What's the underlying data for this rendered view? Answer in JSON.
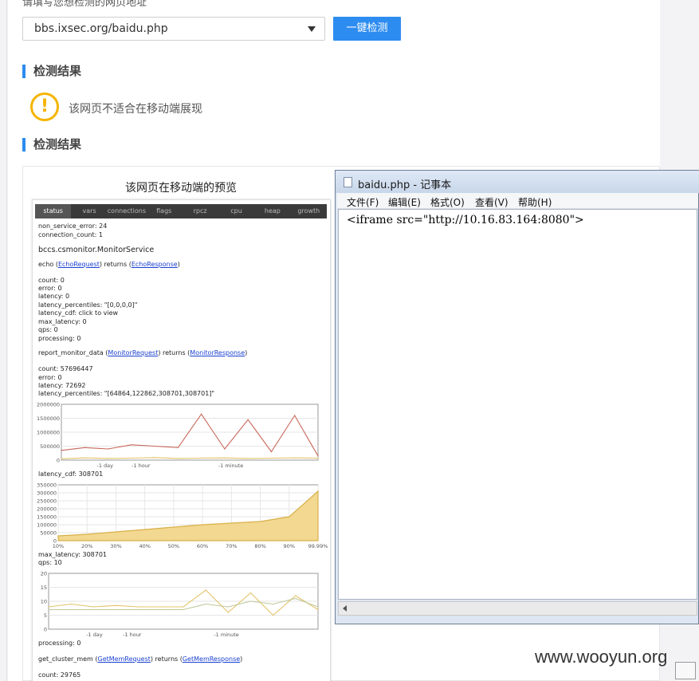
{
  "top_cut_label": "请填写您想检测的网页地址",
  "url_input": {
    "value": "bbs.ixsec.org/baidu.php"
  },
  "check_button": "一键检测",
  "section1_title": "检测结果",
  "warning_text": "该网页不适合在移动端展现",
  "warning_icon": "exclamation-circle-icon",
  "section2_title": "检测结果",
  "preview_title": "该网页在移动端的预览",
  "accent_color": "#2d8cf0",
  "warn_color": "#f5b400",
  "mobile": {
    "tabs": [
      "status",
      "vars",
      "connections",
      "flags",
      "rpcz",
      "cpu",
      "heap",
      "growth"
    ],
    "lines": {
      "l1": "non_service_error: 24",
      "l2": "connection_count: 1",
      "service": "bccs.csmonitor.MonitorService",
      "echo_a": "echo (",
      "echo_req": "EchoRequest",
      "echo_b": ") returns (",
      "echo_resp": "EchoResponse",
      "echo_c": ")",
      "e1": "count: 0",
      "e2": "error: 0",
      "e3": "latency: 0",
      "e4": "latency_percentiles: \"[0,0,0,0]\"",
      "e5": "latency_cdf: click to view",
      "e6": "max_latency: 0",
      "e7": "qps: 0",
      "e8": "processing: 0",
      "rm_a": "report_monitor_data (",
      "rm_req": "MonitorRequest",
      "rm_b": ") returns (",
      "rm_resp": "MonitorResponse",
      "rm_c": ")",
      "r1": "count: 57696447",
      "r2": "error: 0",
      "r3": "latency: 72692",
      "r4": "latency_percentiles: \"[64864,122862,308701,308701]\"",
      "cdf": "latency_cdf: 308701",
      "maxl": "max_latency: 308701",
      "qps": "qps: 10",
      "proc": "processing: 0",
      "gc_a": "get_cluster_mem (",
      "gc_req": "GetMemRequest",
      "gc_b": ") returns (",
      "gc_resp": "GetMemResponse",
      "gc_c": ")",
      "gcount": "count: 29765"
    },
    "chart1": {
      "y_ticks": [
        "2000000",
        "1500000",
        "1000000",
        "500000",
        "0"
      ],
      "x_ticks": [
        "-1 day",
        "-1 hour",
        "-1 minute"
      ]
    },
    "chart2": {
      "y_ticks": [
        "350000",
        "300000",
        "250000",
        "200000",
        "150000",
        "100000",
        "50000",
        "0"
      ],
      "x_ticks": [
        "10%",
        "20%",
        "30%",
        "40%",
        "50%",
        "60%",
        "70%",
        "80%",
        "90%",
        "99.99%"
      ]
    },
    "chart3": {
      "y_ticks": [
        "20",
        "15",
        "10",
        "5",
        "0"
      ],
      "x_ticks": [
        "-1 day",
        "-1 hour",
        "-1 minute"
      ]
    }
  },
  "notepad": {
    "title": "baidu.php - 记事本",
    "menu": [
      "文件(F)",
      "编辑(E)",
      "格式(O)",
      "查看(V)",
      "帮助(H)"
    ],
    "content": "<iframe src=\"http://10.16.83.164:8080\">"
  },
  "watermark": "www.wooyun.org",
  "chart_data": [
    {
      "type": "line",
      "x": [
        "-1 day",
        "-1 hour",
        "-1 minute"
      ],
      "ylim": [
        0,
        2000000
      ],
      "series": [
        {
          "values": [
            350000,
            450000,
            400000,
            550000,
            500000,
            450000,
            1650000,
            400000,
            1450000,
            300000,
            1600000,
            150000
          ]
        },
        {
          "values": [
            50000,
            80000,
            60000,
            70000,
            90000,
            60000,
            70000,
            80000,
            60000,
            70000,
            80000,
            70000
          ]
        }
      ]
    },
    {
      "type": "area",
      "x": [
        "10%",
        "20%",
        "30%",
        "40%",
        "50%",
        "60%",
        "70%",
        "80%",
        "90%",
        "99.99%"
      ],
      "ylim": [
        0,
        350000
      ],
      "series": [
        {
          "values": [
            30000,
            40000,
            55000,
            70000,
            85000,
            100000,
            110000,
            120000,
            150000,
            310000
          ]
        }
      ]
    },
    {
      "type": "line",
      "x": [
        "-1 day",
        "-1 hour",
        "-1 minute"
      ],
      "ylim": [
        0,
        20
      ],
      "series": [
        {
          "values": [
            8,
            9,
            8,
            8.5,
            8,
            8,
            8,
            14,
            6,
            13,
            5,
            12,
            7
          ]
        },
        {
          "values": [
            7,
            7,
            7,
            7,
            7,
            7,
            7,
            9,
            8,
            10,
            9,
            11,
            8
          ]
        }
      ]
    }
  ]
}
